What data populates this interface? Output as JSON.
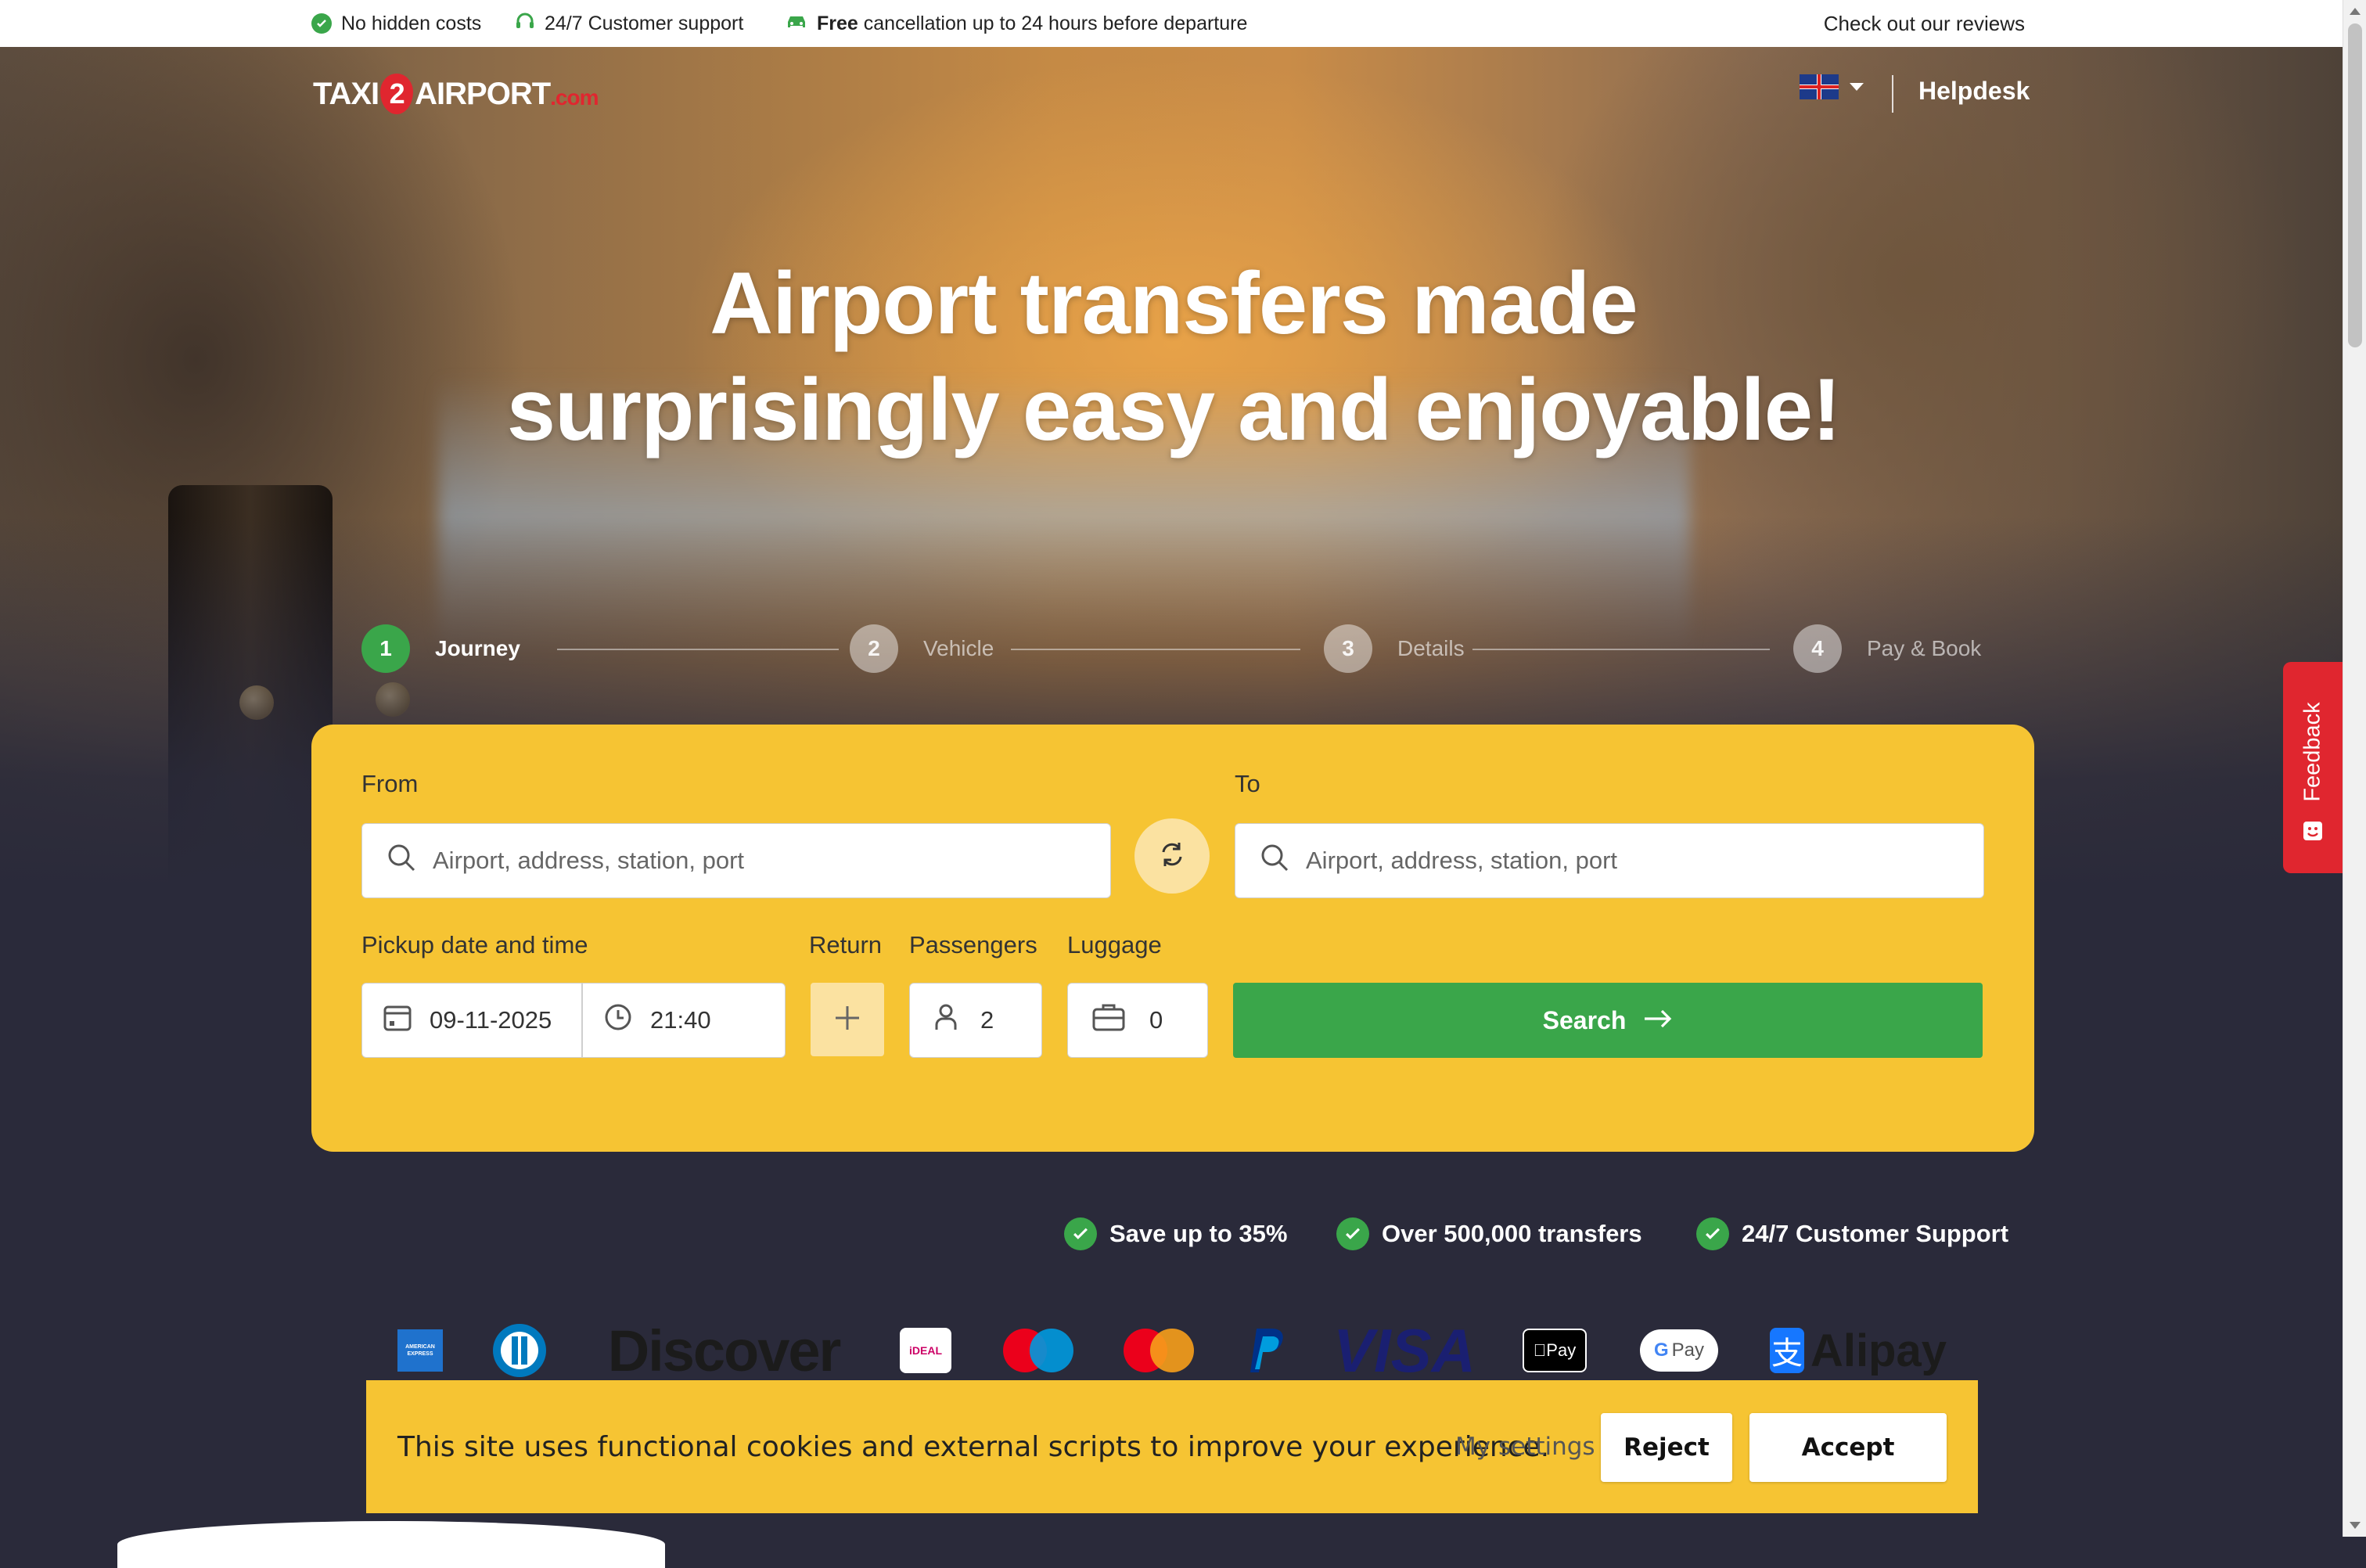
{
  "topbar": {
    "no_hidden_costs": "No hidden costs",
    "support": "24/7 Customer support",
    "free_bold": "Free",
    "free_rest": "cancellation up to 24 hours before departure",
    "reviews": "Check out our reviews"
  },
  "header": {
    "logo_taxi": "TAXI",
    "logo_two": "2",
    "logo_airport": "AIRPORT",
    "logo_com": ".com",
    "helpdesk": "Helpdesk",
    "language_icon": "uk-flag-icon"
  },
  "hero": {
    "headline_line1": "Airport transfers made",
    "headline_line2": "surprisingly easy and enjoyable!"
  },
  "steps": [
    {
      "num": "1",
      "label": "Journey"
    },
    {
      "num": "2",
      "label": "Vehicle"
    },
    {
      "num": "3",
      "label": "Details"
    },
    {
      "num": "4",
      "label": "Pay & Book"
    }
  ],
  "form": {
    "from_label": "From",
    "to_label": "To",
    "from_placeholder": "Airport, address, station, port",
    "to_placeholder": "Airport, address, station, port",
    "pickup_label": "Pickup date and time",
    "return_label": "Return",
    "passengers_label": "Passengers",
    "luggage_label": "Luggage",
    "date": "09-11-2025",
    "time": "21:40",
    "passengers": "2",
    "luggage": "0",
    "search": "Search"
  },
  "features": [
    "Save up to 35%",
    "Over 500,000 transfers",
    "24/7 Customer Support"
  ],
  "payments": {
    "amex": "AMERICAN EXPRESS",
    "discover": "Discover",
    "ideal": "iDEAL",
    "visa": "VISA",
    "applepay": "Pay",
    "gpay": "Pay",
    "alipay": "Alipay"
  },
  "cookie": {
    "message": "This site uses functional cookies and external scripts to improve your experience.",
    "settings": "My settings",
    "reject": "Reject",
    "accept": "Accept"
  },
  "feedback": "Feedback",
  "colors": {
    "brand_red": "#e0262f",
    "green": "#3aa64a",
    "yellow": "#f6c433",
    "dark": "#2a2a3a"
  }
}
